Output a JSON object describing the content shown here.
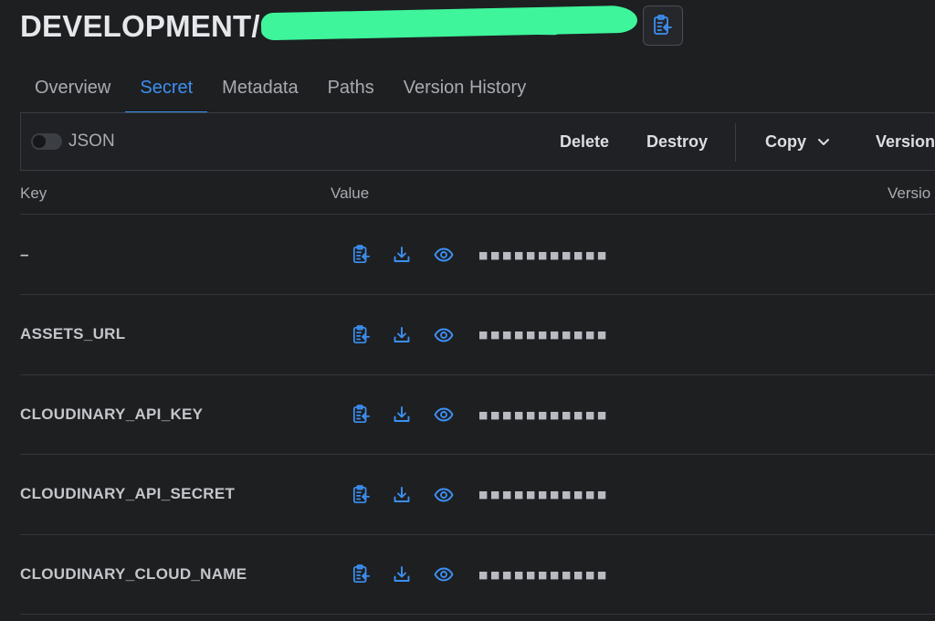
{
  "header": {
    "title": "DEVELOPMENT/",
    "copy_icon": "clipboard-copy-icon"
  },
  "tabs": [
    {
      "label": "Overview"
    },
    {
      "label": "Secret",
      "active": true
    },
    {
      "label": "Metadata"
    },
    {
      "label": "Paths"
    },
    {
      "label": "Version History"
    }
  ],
  "toolbar": {
    "json_toggle_label": "JSON",
    "json_toggle_on": false,
    "delete_label": "Delete",
    "destroy_label": "Destroy",
    "copy_label": "Copy",
    "version_label": "Version"
  },
  "table": {
    "columns": {
      "key": "Key",
      "value": "Value",
      "version": "Versio"
    },
    "rows": [
      {
        "key": "–",
        "value": "■■■■■■■■■■■"
      },
      {
        "key": "ASSETS_URL",
        "value": "■■■■■■■■■■■"
      },
      {
        "key": "CLOUDINARY_API_KEY",
        "value": "■■■■■■■■■■■"
      },
      {
        "key": "CLOUDINARY_API_SECRET",
        "value": "■■■■■■■■■■■"
      },
      {
        "key": "CLOUDINARY_CLOUD_NAME",
        "value": "■■■■■■■■■■■"
      }
    ],
    "row_icons": [
      "clipboard-copy-icon",
      "download-icon",
      "eye-icon"
    ]
  },
  "colors": {
    "background": "#1d1f21",
    "accent": "#3d8ff2",
    "redaction": "#3ef59b",
    "border": "#3a3d42"
  }
}
